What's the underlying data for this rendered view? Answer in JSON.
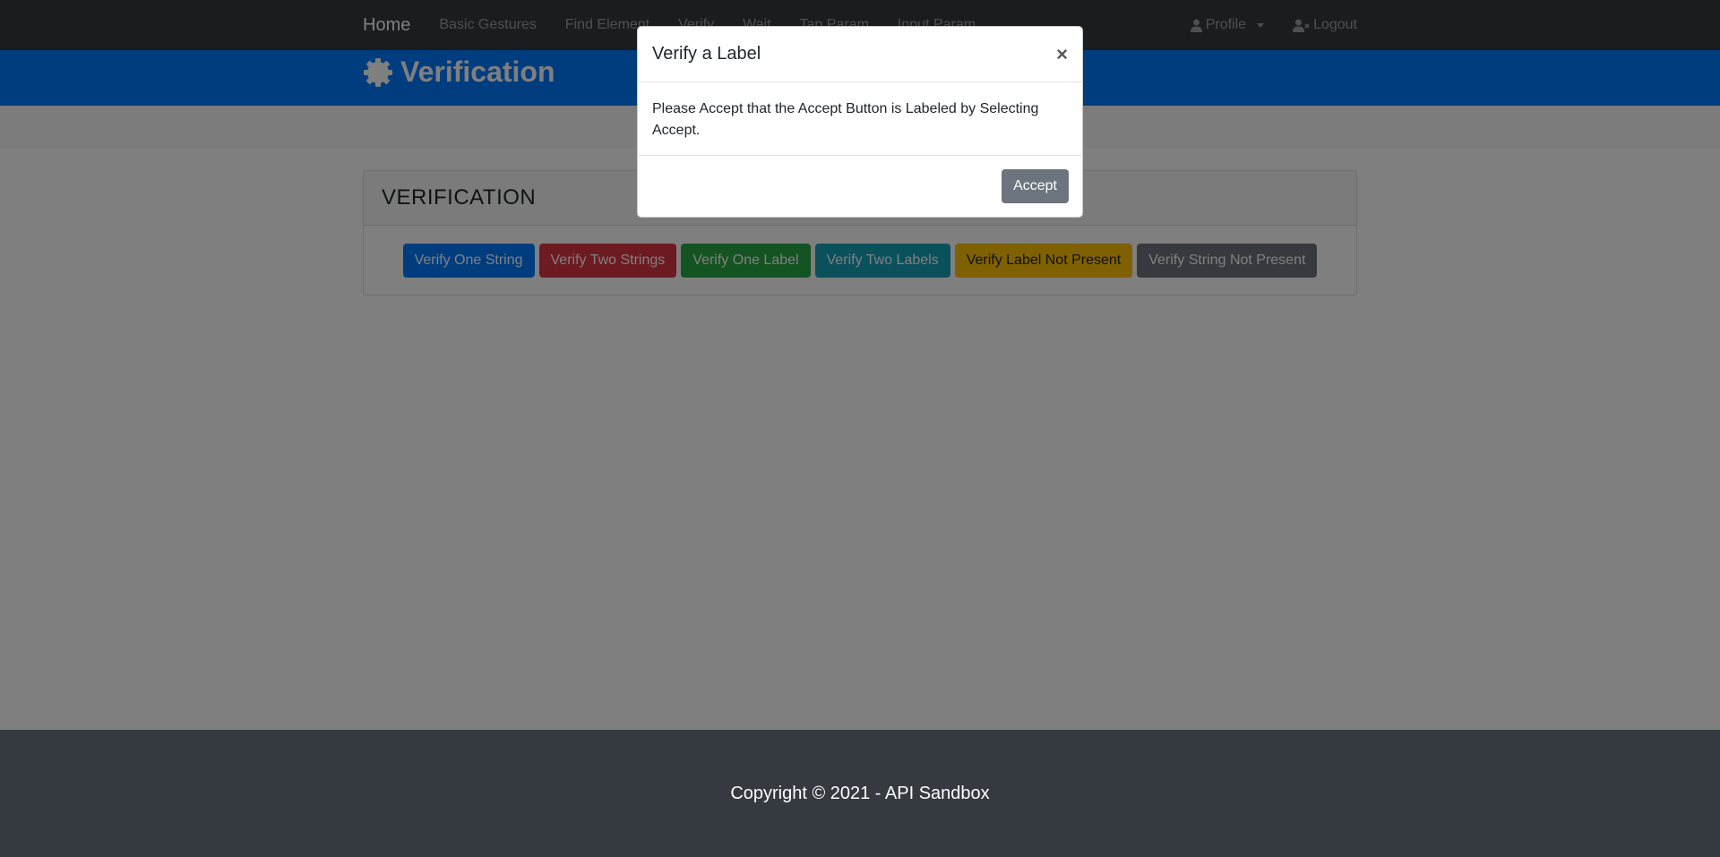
{
  "navbar": {
    "brand": "Home",
    "links": [
      "Basic Gestures",
      "Find Element",
      "Verify",
      "Wait",
      "Tap Param",
      "Input Param"
    ],
    "profile": "Profile",
    "logout": "Logout"
  },
  "hero": {
    "title": "Verification"
  },
  "card": {
    "title": "VERIFICATION",
    "buttons": [
      "Verify One String",
      "Verify Two Strings",
      "Verify One Label",
      "Verify Two Labels",
      "Verify Label Not Present",
      "Verify String Not Present"
    ]
  },
  "modal": {
    "title": "Verify a Label",
    "close": "×",
    "body": "Please Accept that the Accept Button is Labeled by Selecting Accept.",
    "accept": "Accept"
  },
  "footer": {
    "text": "Copyright © 2021 - API Sandbox"
  },
  "icons": {
    "hero": "gear-icon",
    "profile": "user-icon",
    "logout": "user-times-icon"
  }
}
